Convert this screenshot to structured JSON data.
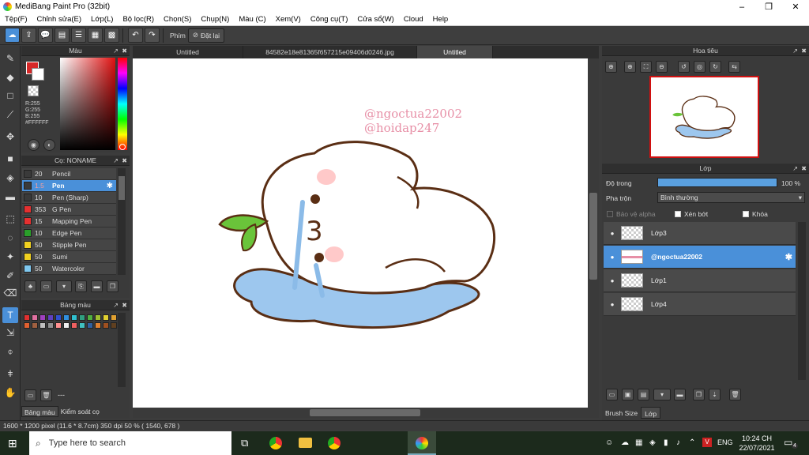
{
  "window": {
    "title": "MediBang Paint Pro (32bit)"
  },
  "menu": [
    "Tệp(F)",
    "Chỉnh sửa(E)",
    "Lớp(L)",
    "Bộ lọc(R)",
    "Chọn(S)",
    "Chụp(N)",
    "Màu (C)",
    "Xem(V)",
    "Công cụ(T)",
    "Cửa sổ(W)",
    "Cloud",
    "Help"
  ],
  "toolbar": {
    "phim_label": "Phím",
    "reset_label": "Đặt lại"
  },
  "color_panel": {
    "title": "Màu",
    "rgb": {
      "r": "R:255",
      "g": "G:255",
      "b": "B:255",
      "hex": "#FFFFFF"
    }
  },
  "brush_panel": {
    "title": "Cọ: NONAME",
    "brushes": [
      {
        "size": "20",
        "name": "Pencil",
        "color": "#3a3a3a"
      },
      {
        "size": "1.5",
        "name": "Pen",
        "color": "#3a3a3a"
      },
      {
        "size": "10",
        "name": "Pen (Sharp)",
        "color": "#3a3a3a"
      },
      {
        "size": "353",
        "name": "G Pen",
        "color": "#e53030"
      },
      {
        "size": "15",
        "name": "Mapping Pen",
        "color": "#e53030"
      },
      {
        "size": "10",
        "name": "Edge Pen",
        "color": "#2aa02a"
      },
      {
        "size": "50",
        "name": "Stipple Pen",
        "color": "#f0d020"
      },
      {
        "size": "50",
        "name": "Sumi",
        "color": "#f0d020"
      },
      {
        "size": "50",
        "name": "Watercolor",
        "color": "#7fc8f0"
      }
    ]
  },
  "palette_panel": {
    "title": "Bảng màu",
    "colors": [
      "#e03030",
      "#e070a0",
      "#a040c0",
      "#6040c0",
      "#3050d0",
      "#3090e0",
      "#30c0d0",
      "#30a080",
      "#50b040",
      "#a0c030",
      "#e0d030",
      "#e0a030",
      "#e06030",
      "#a06040",
      "#c0c0c0",
      "#909090",
      "#ff9090",
      "#f0f0f0",
      "#f06060",
      "#40c0c0",
      "#3060a0",
      "#e08030",
      "#a05020",
      "#604020"
    ],
    "footer_text": "---",
    "tabs": [
      "Bảng màu",
      "Kiểm soát cọ"
    ]
  },
  "doc_tabs": [
    "Untitled",
    "84582e18e81365f657215e09406d0246.jpg",
    "Untitled"
  ],
  "canvas": {
    "watermark_1": "@ngoctua22002",
    "watermark_2": "@hoidap247",
    "face_number": "3"
  },
  "status": {
    "text": "1600 * 1200 pixel    (11.6 * 8.7cm)    350 dpi    50 %    ( 1540, 678 )"
  },
  "navigator": {
    "title": "Hoa tiêu"
  },
  "layer_panel": {
    "title": "Lớp",
    "opacity_label": "Độ trong",
    "opacity_value": "100 %",
    "opacity": 1.0,
    "blend_label": "Pha trộn",
    "blend_value": "Bình thường",
    "protect_alpha": "Bảo vệ alpha",
    "clipping": "Xén bớt",
    "lock": "Khóa",
    "layers": [
      {
        "name": "Lớp3",
        "selected": false
      },
      {
        "name": "@ngoctua22002",
        "selected": true
      },
      {
        "name": "Lớp1",
        "selected": false
      },
      {
        "name": "Lớp4",
        "selected": false
      }
    ],
    "tabs": [
      "Brush Size",
      "Lớp"
    ]
  },
  "taskbar": {
    "search_placeholder": "Type here to search",
    "lang": "ENG",
    "time": "10:24 CH",
    "date": "22/07/2021",
    "notification_count": "4"
  }
}
